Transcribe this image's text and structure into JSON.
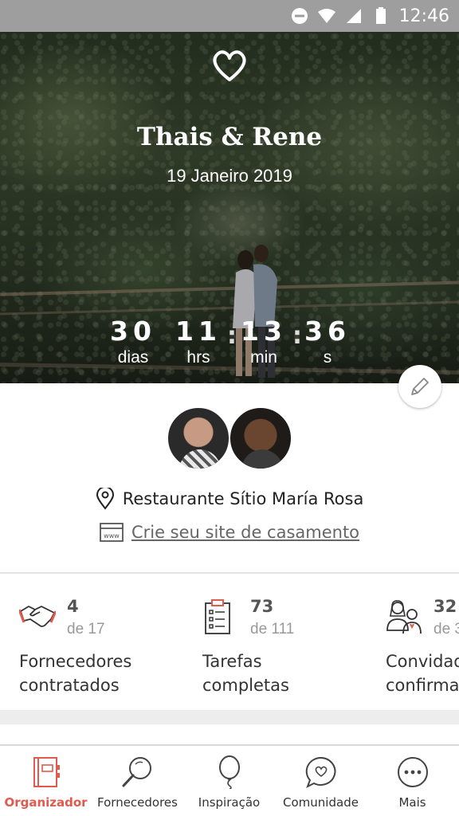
{
  "status_bar": {
    "time": "12:46"
  },
  "hero": {
    "names": "Thais & Rene",
    "date": "19 Janeiro 2019",
    "countdown": [
      {
        "value": "30",
        "label": "dias"
      },
      {
        "value": "11",
        "label": "hrs"
      },
      {
        "value": "13",
        "label": "min"
      },
      {
        "value": "36",
        "label": "s"
      }
    ]
  },
  "profile": {
    "venue": "Restaurante Sítio María Rosa",
    "site_link": "Crie seu site de casamento"
  },
  "stats": [
    {
      "value": "4",
      "of": "de 17",
      "label_line1": "Fornecedores",
      "label_line2": "contratados",
      "icon": "handshake-icon"
    },
    {
      "value": "73",
      "of": "de 111",
      "label_line1": "Tarefas",
      "label_line2": "completas",
      "icon": "clipboard-checklist-icon"
    },
    {
      "value": "32",
      "of": "de 3",
      "label_line1": "Convidad",
      "label_line2": "confirma",
      "icon": "guests-icon"
    }
  ],
  "bottom_nav": [
    {
      "label": "Organizador",
      "icon": "notebook-icon",
      "active": true
    },
    {
      "label": "Fornecedores",
      "icon": "magnifier-icon",
      "active": false
    },
    {
      "label": "Inspiração",
      "icon": "balloon-icon",
      "active": false
    },
    {
      "label": "Comunidade",
      "icon": "chat-heart-icon",
      "active": false
    },
    {
      "label": "Mais",
      "icon": "more-dots-icon",
      "active": false
    }
  ],
  "colors": {
    "accent": "#e05a4e",
    "status_bar": "#9e9e9e"
  }
}
